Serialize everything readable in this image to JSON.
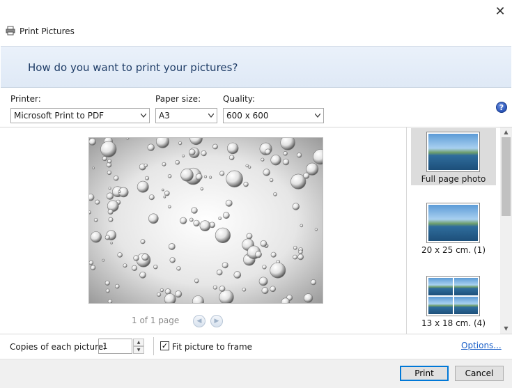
{
  "window": {
    "title": "Print Pictures",
    "close_glyph": "✕"
  },
  "header": {
    "question": "How do you want to print your pictures?"
  },
  "options": {
    "printer_label": "Printer:",
    "printer_value": "Microsoft Print to PDF",
    "paper_size_label": "Paper size:",
    "paper_size_value": "A3",
    "quality_label": "Quality:",
    "quality_value": "600 x 600",
    "help_glyph": "?"
  },
  "preview": {
    "page_indicator": "1 of 1 page",
    "prev_glyph": "◀",
    "next_glyph": "▶"
  },
  "layouts": [
    {
      "label": "Full page photo",
      "selected": true
    },
    {
      "label": "20 x 25 cm. (1)",
      "selected": false
    },
    {
      "label": "13 x 18 cm. (4)",
      "selected": false
    }
  ],
  "scrollbar": {
    "up_glyph": "▲",
    "down_glyph": "▼"
  },
  "bottom": {
    "copies_label": "Copies of each picture:",
    "copies_value": "1",
    "fit_label": "Fit picture to frame",
    "fit_checked": true,
    "check_glyph": "✓",
    "options_link": "Options..."
  },
  "footer": {
    "print_label": "Print",
    "cancel_label": "Cancel"
  },
  "icons": {
    "app": "printer-icon",
    "close": "close-icon",
    "help": "help-icon",
    "dropdown": "chevron-down-icon"
  },
  "colors": {
    "header_text": "#1e3c66",
    "link": "#1a5fc8",
    "default_button_border": "#0078d7"
  }
}
